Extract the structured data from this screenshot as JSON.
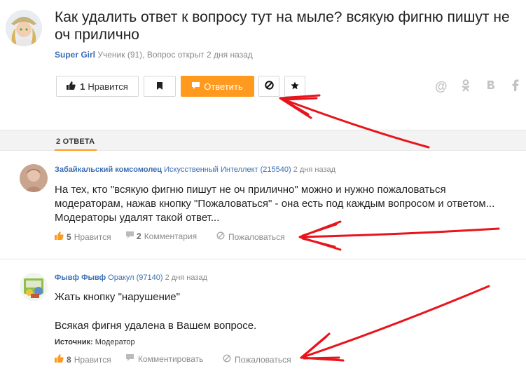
{
  "question": {
    "title": "Как удалить ответ к вопросу тут на мыле? всякую фигню пишут не оч прилично",
    "author": "Super Girl",
    "meta": "Ученик (91), Вопрос открыт 2 дня назад"
  },
  "toolbar": {
    "like_count": "1",
    "like_label": "Нравится",
    "answer_label": "Ответить",
    "like_icon": "thumbs-up-icon",
    "bookmark_icon": "bookmark-icon",
    "answer_icon": "reply-icon",
    "report_icon": "report-icon",
    "favorite_icon": "star-icon"
  },
  "share": [
    {
      "name": "at-icon",
      "glyph": "@"
    },
    {
      "name": "odnoklassniki-icon",
      "glyph": "ок"
    },
    {
      "name": "vkontakte-icon",
      "glyph": "в"
    },
    {
      "name": "facebook-icon",
      "glyph": "f"
    }
  ],
  "answers_tab": {
    "label": "2 ОТВЕТА"
  },
  "answers": [
    {
      "author": "Забайкальский комсомолец",
      "rank": "Искусственный Интеллект (215540)",
      "time": "2 дня назад",
      "lines": [
        "На тех, кто \"всякую фигню пишут не оч прилично\" можно и нужно пожаловаться",
        "модераторам, нажав кнопку \"Пожаловаться\" - она есть под каждым вопросом и ответом...",
        "Модераторы удалят такой ответ..."
      ],
      "likes": "5",
      "like_label": "Нравится",
      "comments_count": "2",
      "comments_label": "Комментария",
      "report_label": "Пожаловаться"
    },
    {
      "author": "Фывф Фывф",
      "rank": "Оракул (97140)",
      "time": "2 дня назад",
      "line1": "Жать кнопку \"нарушение\"",
      "line2": "Всякая фигня удалена в Вашем вопросе.",
      "source_label": "Источник:",
      "source_value": "Модератор",
      "likes": "8",
      "like_label": "Нравится",
      "comments_label": "Комментировать",
      "report_label": "Пожаловаться"
    }
  ],
  "colors": {
    "accent": "#ff9a1f",
    "link": "#3b6fb6",
    "arrow": "#e8141c"
  }
}
